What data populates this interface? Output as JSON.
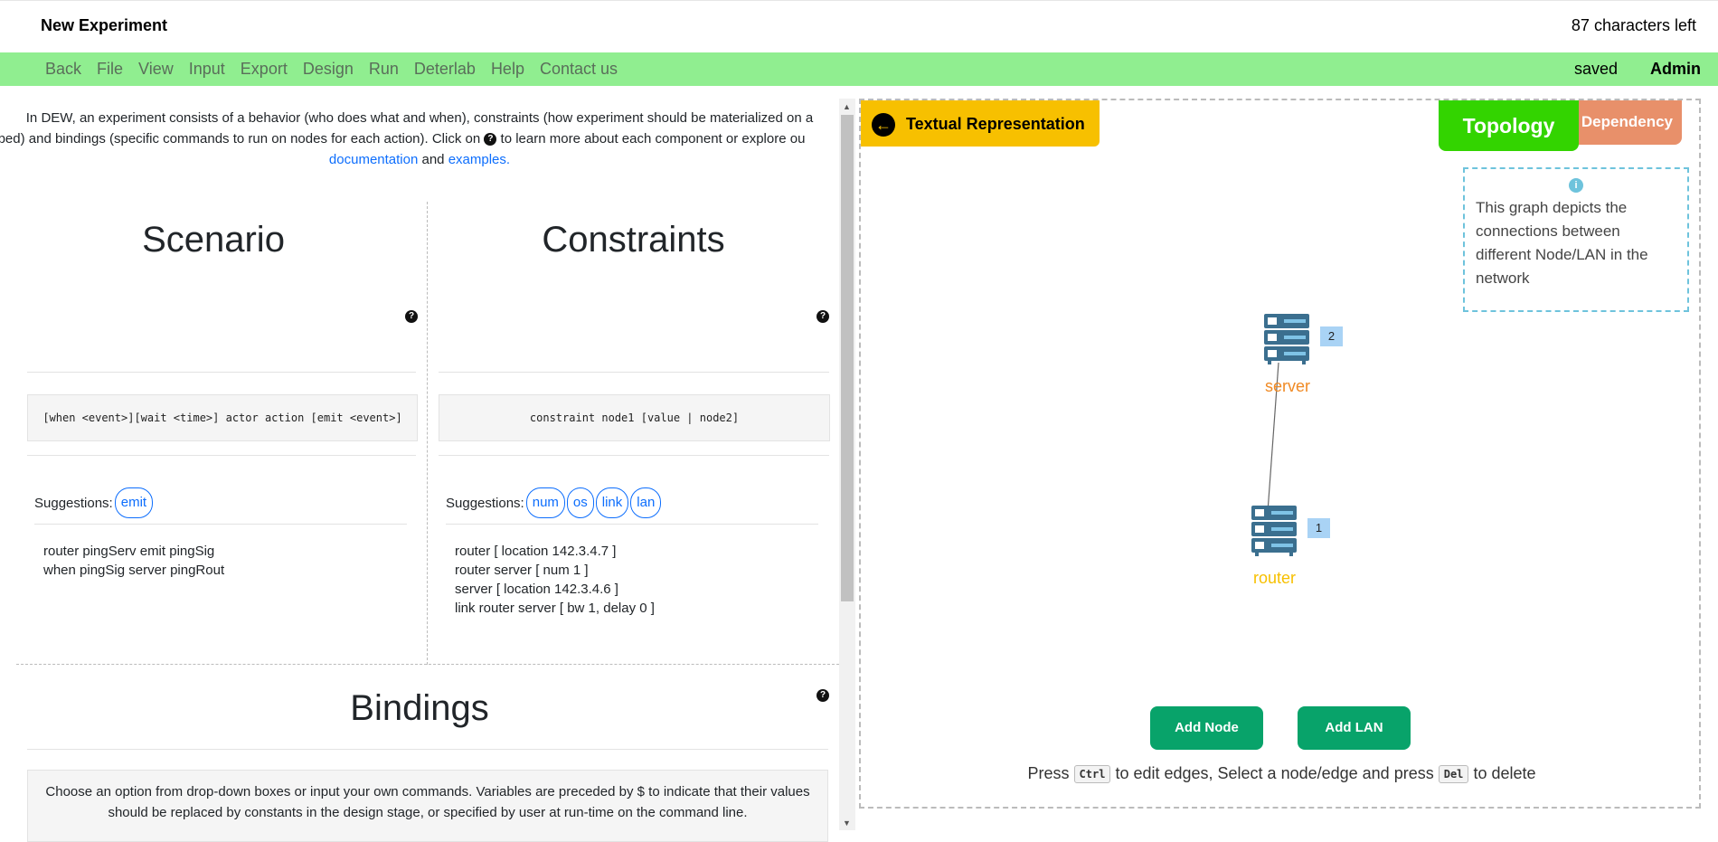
{
  "header": {
    "title": "New Experiment",
    "chars_left": "87 characters left"
  },
  "menu": {
    "items": [
      "Back",
      "File",
      "View",
      "Input",
      "Export",
      "Design",
      "Run",
      "Deterlab",
      "Help",
      "Contact us"
    ],
    "status": "saved",
    "user": "Admin",
    "color": "#90ee90"
  },
  "intro": {
    "line1": "In DEW, an experiment consists of a behavior (who does what and when), constraints (how experiment should be materialized on a",
    "line2a": "estbed) and bindings (specific commands to run on nodes for each action). Click on",
    "line2b": "to learn more about each component or explore ou",
    "doc_link": "documentation",
    "and": "and",
    "ex_link": "examples."
  },
  "scenario": {
    "title": "Scenario",
    "syntax": "[when <event>][wait <time>] actor action [emit <event>]",
    "suggestions_label": "Suggestions:",
    "suggestions": [
      "emit"
    ],
    "lines": [
      "router pingServ emit pingSig",
      "when pingSig server pingRout"
    ]
  },
  "constraints": {
    "title": "Constraints",
    "syntax": "constraint node1 [value | node2]",
    "suggestions_label": "Suggestions:",
    "suggestions": [
      "num",
      "os",
      "link",
      "lan"
    ],
    "lines": [
      "router [ location 142.3.4.7 ]",
      "router server [ num 1 ]",
      "server [ location 142.3.4.6 ]",
      "link router server [ bw 1, delay 0 ]"
    ]
  },
  "bindings": {
    "title": "Bindings",
    "desc1": "Choose an option from drop-down boxes or input your own commands. Variables are preceded by $ to indicate that their values",
    "desc2": "should be replaced by constants in the design stage, or specified by user at run-time on the command line."
  },
  "topology": {
    "tab_text": "Textual Representation",
    "tab_topology": "Topology",
    "tab_dependency": "Dependency",
    "info": "This graph depicts the connections between different Node/LAN in the network",
    "nodes": [
      {
        "name": "server",
        "id": "2",
        "color": "#f08a24"
      },
      {
        "name": "router",
        "id": "1",
        "color": "#f7c000"
      }
    ],
    "add_node": "Add Node",
    "add_lan": "Add LAN",
    "hint_press": "Press",
    "hint_ctrl": "Ctrl",
    "hint_mid": "to edit edges, Select a node/edge and press",
    "hint_del": "Del",
    "hint_end": "to delete"
  }
}
